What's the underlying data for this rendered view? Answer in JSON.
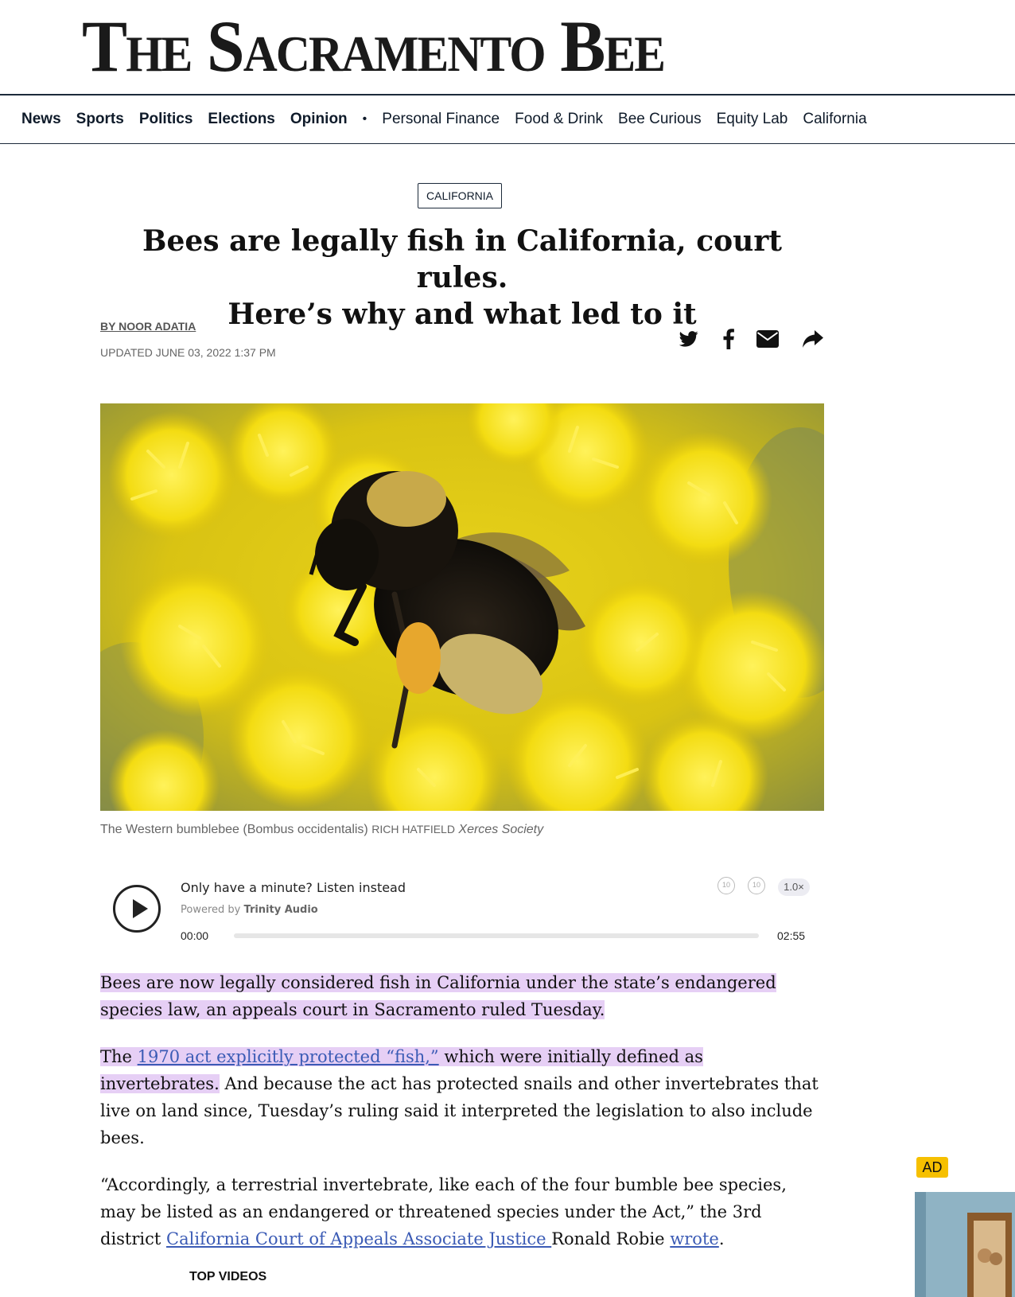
{
  "masthead": {
    "title": "The Sacramento Bee"
  },
  "nav": {
    "primary": [
      "News",
      "Sports",
      "Politics",
      "Elections",
      "Opinion"
    ],
    "separator": "•",
    "secondary": [
      "Personal Finance",
      "Food & Drink",
      "Bee Curious",
      "Equity Lab",
      "California"
    ]
  },
  "article": {
    "section": "CALIFORNIA",
    "headline_line1": "Bees are legally fish in California, court rules.",
    "headline_line2": "Here’s why and what led to it",
    "byline": "BY NOOR ADATIA",
    "updated": "UPDATED JUNE 03, 2022 1:37 PM",
    "share_icons": [
      "twitter-icon",
      "facebook-icon",
      "email-icon",
      "share-icon"
    ],
    "caption": {
      "text": "The Western bumblebee (Bombus occidentalis) ",
      "credit": "RICH HATFIELD",
      "org": "Xerces Society"
    },
    "paragraph1": "Bees are now legally considered fish in California under the state’s endangered species law, an appeals court in Sacramento ruled Tuesday.",
    "paragraph2": {
      "pre": "The ",
      "link": "1970 act explicitly protected “fish,”",
      "mid": " which were initially defined as invertebrates.",
      "rest": " And because the act has protected snails and other invertebrates that live on land since, Tuesday’s ruling said it interpreted the legislation to also include bees."
    },
    "paragraph3": {
      "pre": "“Accordingly, a terrestrial invertebrate, like each of the four bumble bee species, may be listed as an endangered or threatened species under the Act,” the 3rd district ",
      "link1": "California Court of Appeals Associate Justice ",
      "mid": "Ronald Robie ",
      "link2": "wrote",
      "end": "."
    },
    "top_videos": "TOP VIDEOS"
  },
  "player": {
    "title": "Only have a minute? Listen instead",
    "powered_prefix": "Powered by",
    "powered_brand": "Trinity Audio",
    "time_start": "00:00",
    "time_end": "02:55",
    "speed": "1.0×",
    "skip_back": "10",
    "skip_forward": "10",
    "progress": 0
  },
  "ad": {
    "badge": "AD"
  }
}
